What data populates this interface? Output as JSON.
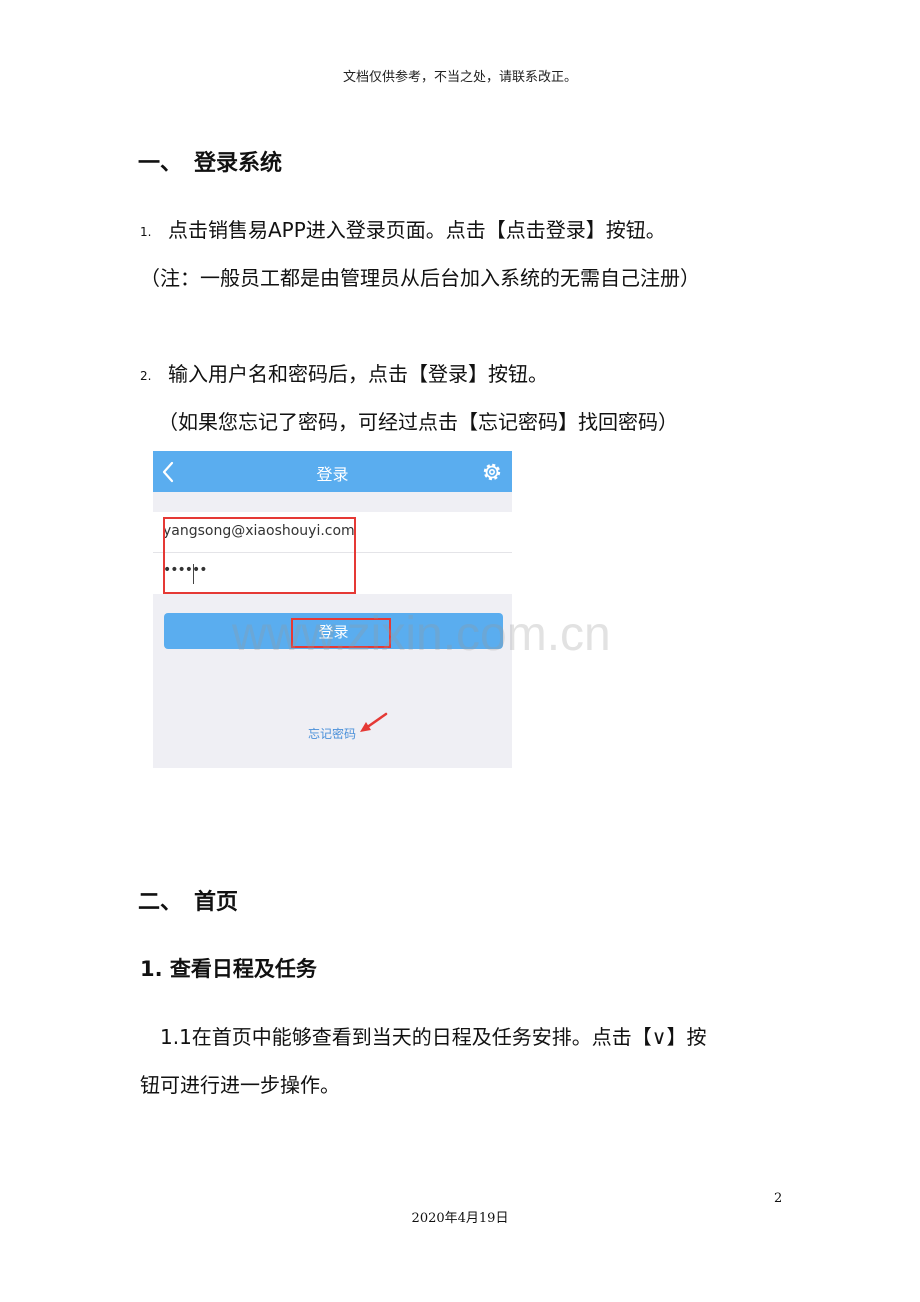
{
  "header_note": "文档仅供参考，不当之处，请联系改正。",
  "section1": {
    "num": "一、",
    "title": "登录系统",
    "step1_num": "1.",
    "step1_text": "点击销售易APP进入登录页面。点击【点击登录】按钮。",
    "step1_note": "（注：一般员工都是由管理员从后台加入系统的无需自己注册）",
    "step2_num": "2.",
    "step2_text": "输入用户名和密码后，点击【登录】按钮。",
    "step2_note": "（如果您忘记了密码，可经过点击【忘记密码】找回密码）"
  },
  "phone": {
    "title": "登录",
    "username": "yangsong@xiaoshouyi.com",
    "password": "••••••",
    "login_button": "登录",
    "forgot_link": "忘记密码",
    "bar_color": "#5aadef",
    "highlight_color": "#e53935"
  },
  "watermark": "www.zixin.com.cn",
  "section2": {
    "num": "二、",
    "title": "首页",
    "sub_title": "1.  查看日程及任务",
    "para_line1": "1.1在首页中能够查看到当天的日程及任务安排。点击【∨】按",
    "para_line2": "钮可进行进一步操作。"
  },
  "footer": {
    "page_number": "2",
    "date": "2020年4月19日"
  }
}
